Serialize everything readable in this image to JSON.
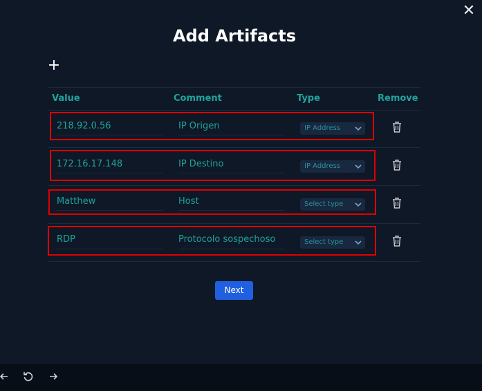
{
  "dialog": {
    "title": "Add Artifacts",
    "close_glyph": "✕",
    "add_glyph": "+"
  },
  "table": {
    "headers": {
      "value": "Value",
      "comment": "Comment",
      "type": "Type",
      "remove": "Remove"
    },
    "rows": [
      {
        "value": "218.92.0.56",
        "comment": "IP Origen",
        "type": "IP Address"
      },
      {
        "value": "172.16.17.148",
        "comment": "IP Destino",
        "type": "IP Address"
      },
      {
        "value": "Matthew",
        "comment": "Host",
        "type": "Select type"
      },
      {
        "value": "RDP",
        "comment": "Protocolo sospechoso",
        "type": "Select type"
      }
    ]
  },
  "actions": {
    "next_label": "Next"
  },
  "icons": {
    "close": "close-icon",
    "add": "plus-icon",
    "remove": "trash-icon",
    "dropdown": "chevron-down-icon",
    "back": "arrow-left-icon",
    "refresh": "refresh-icon",
    "forward": "arrow-right-icon"
  },
  "colors": {
    "background": "#0f1827",
    "accent_teal": "#1fa39a",
    "highlight_red": "#e00000",
    "primary_button": "#2060e0"
  }
}
